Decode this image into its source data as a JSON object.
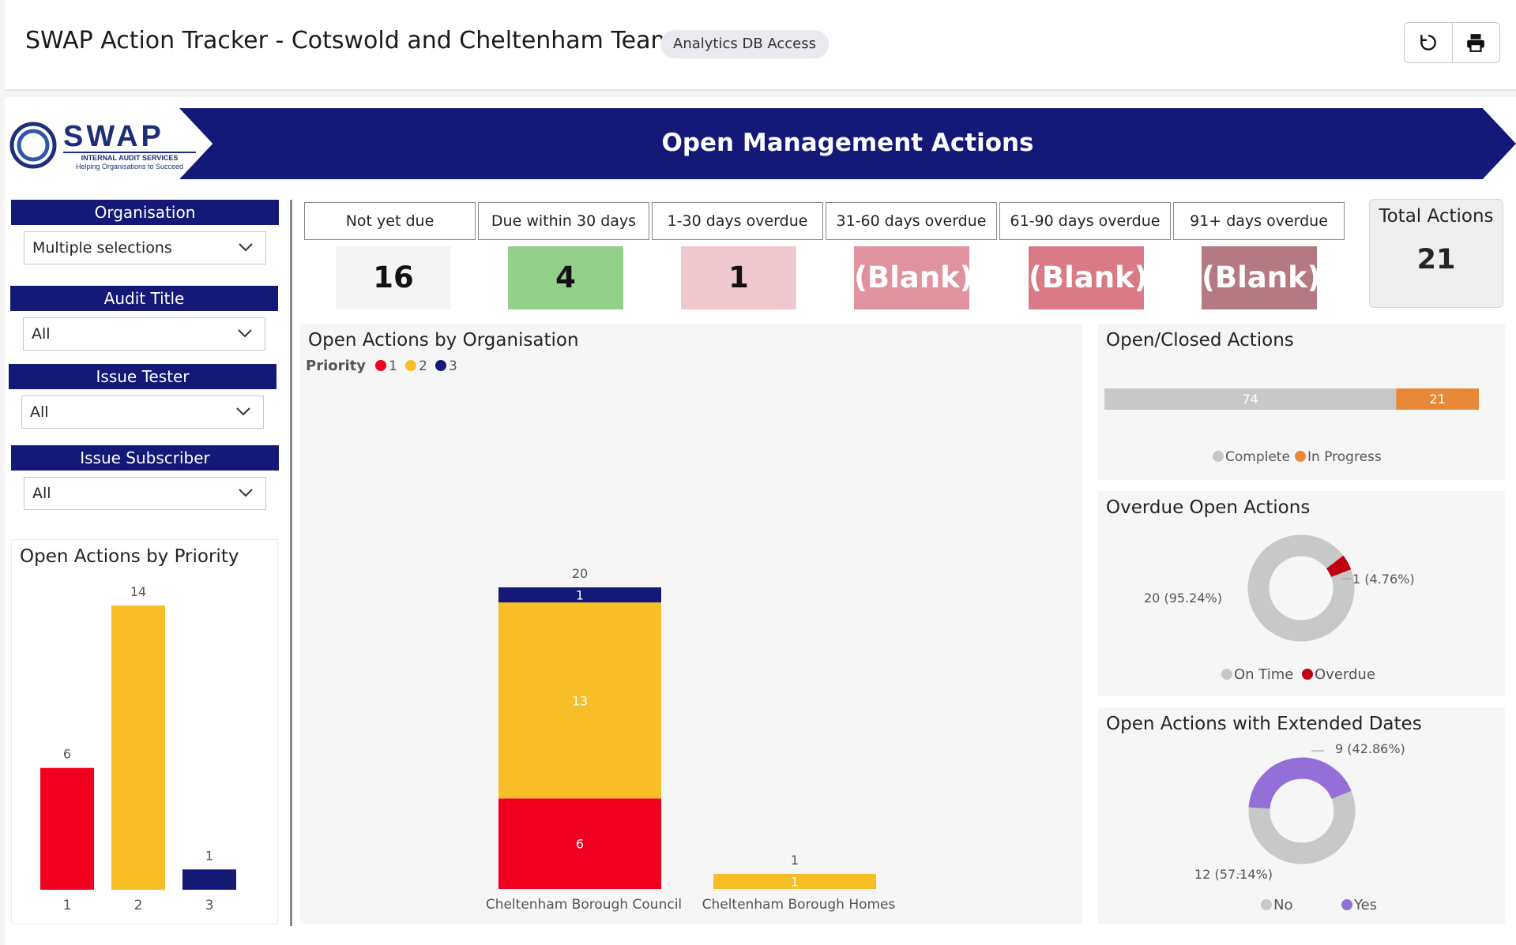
{
  "header": {
    "title": "SWAP Action Tracker - Cotswold and Cheltenham Team",
    "badge": "Analytics DB Access",
    "refresh_icon": "refresh-icon",
    "print_icon": "print-icon"
  },
  "banner": {
    "title": "Open Management Actions"
  },
  "logo": {
    "word": "SWAP",
    "line1": "INTERNAL AUDIT SERVICES",
    "line2": "Helping Organisations to Succeed"
  },
  "filters": [
    {
      "label": "Organisation",
      "value": "Multiple selections"
    },
    {
      "label": "Audit Title",
      "value": "All"
    },
    {
      "label": "Issue Tester",
      "value": "All"
    },
    {
      "label": "Issue Subscriber",
      "value": "All"
    }
  ],
  "kpis": [
    {
      "label": "Not yet due",
      "value": "16",
      "color": "#f4f4f4",
      "text_color": "#111111"
    },
    {
      "label": "Due within 30 days",
      "value": "4",
      "color": "#93d18a",
      "text_color": "#111111"
    },
    {
      "label": "1-30 days overdue",
      "value": "1",
      "color": "#f0c8cf",
      "text_color": "#111111"
    },
    {
      "label": "31-60 days overdue",
      "value": "(Blank)",
      "color": "#e0929f",
      "text_color": "#ffffff"
    },
    {
      "label": "61-90 days overdue",
      "value": "(Blank)",
      "color": "#d97a86",
      "text_color": "#ffffff"
    },
    {
      "label": "91+ days overdue",
      "value": "(Blank)",
      "color": "#b47983",
      "text_color": "#ffffff"
    }
  ],
  "total": {
    "label": "Total Actions",
    "value": "21"
  },
  "colors": {
    "p1": "#f0001e",
    "p2": "#f8be28",
    "p3": "#141978",
    "complete": "#c8c8c8",
    "in_progress": "#e8893a",
    "overdue": "#c00012",
    "yes": "#9370d8"
  },
  "chart_data": [
    {
      "type": "bar",
      "title": "Open Actions by Priority",
      "categories": [
        "1",
        "2",
        "3"
      ],
      "values": [
        6,
        14,
        1
      ],
      "colors": [
        "#f0001e",
        "#f8be28",
        "#141978"
      ]
    },
    {
      "type": "bar",
      "stacked": true,
      "title": "Open Actions by Organisation",
      "legend_title": "Priority",
      "categories": [
        "Cheltenham Borough Council",
        "Cheltenham Borough Homes"
      ],
      "series": [
        {
          "name": "1",
          "values": [
            6,
            0
          ],
          "color": "#f0001e"
        },
        {
          "name": "2",
          "values": [
            13,
            1
          ],
          "color": "#f8be28"
        },
        {
          "name": "3",
          "values": [
            1,
            0
          ],
          "color": "#141978"
        }
      ],
      "totals": [
        20,
        1
      ]
    },
    {
      "type": "bar",
      "stacked": true,
      "orientation": "horizontal",
      "title": "Open/Closed Actions",
      "series": [
        {
          "name": "Complete",
          "value": 74,
          "color": "#c8c8c8"
        },
        {
          "name": "In Progress",
          "value": 21,
          "color": "#e8893a"
        }
      ]
    },
    {
      "type": "pie",
      "donut": true,
      "title": "Overdue Open Actions",
      "slices": [
        {
          "name": "On Time",
          "value": 20,
          "label": "20 (95.24%)",
          "color": "#c8c8c8"
        },
        {
          "name": "Overdue",
          "value": 1,
          "label": "1 (4.76%)",
          "color": "#c00012"
        }
      ]
    },
    {
      "type": "pie",
      "donut": true,
      "title": "Open Actions with Extended Dates",
      "slices": [
        {
          "name": "No",
          "value": 12,
          "label": "12 (57.14%)",
          "color": "#c8c8c8"
        },
        {
          "name": "Yes",
          "value": 9,
          "label": "9 (42.86%)",
          "color": "#9370d8"
        }
      ]
    }
  ]
}
